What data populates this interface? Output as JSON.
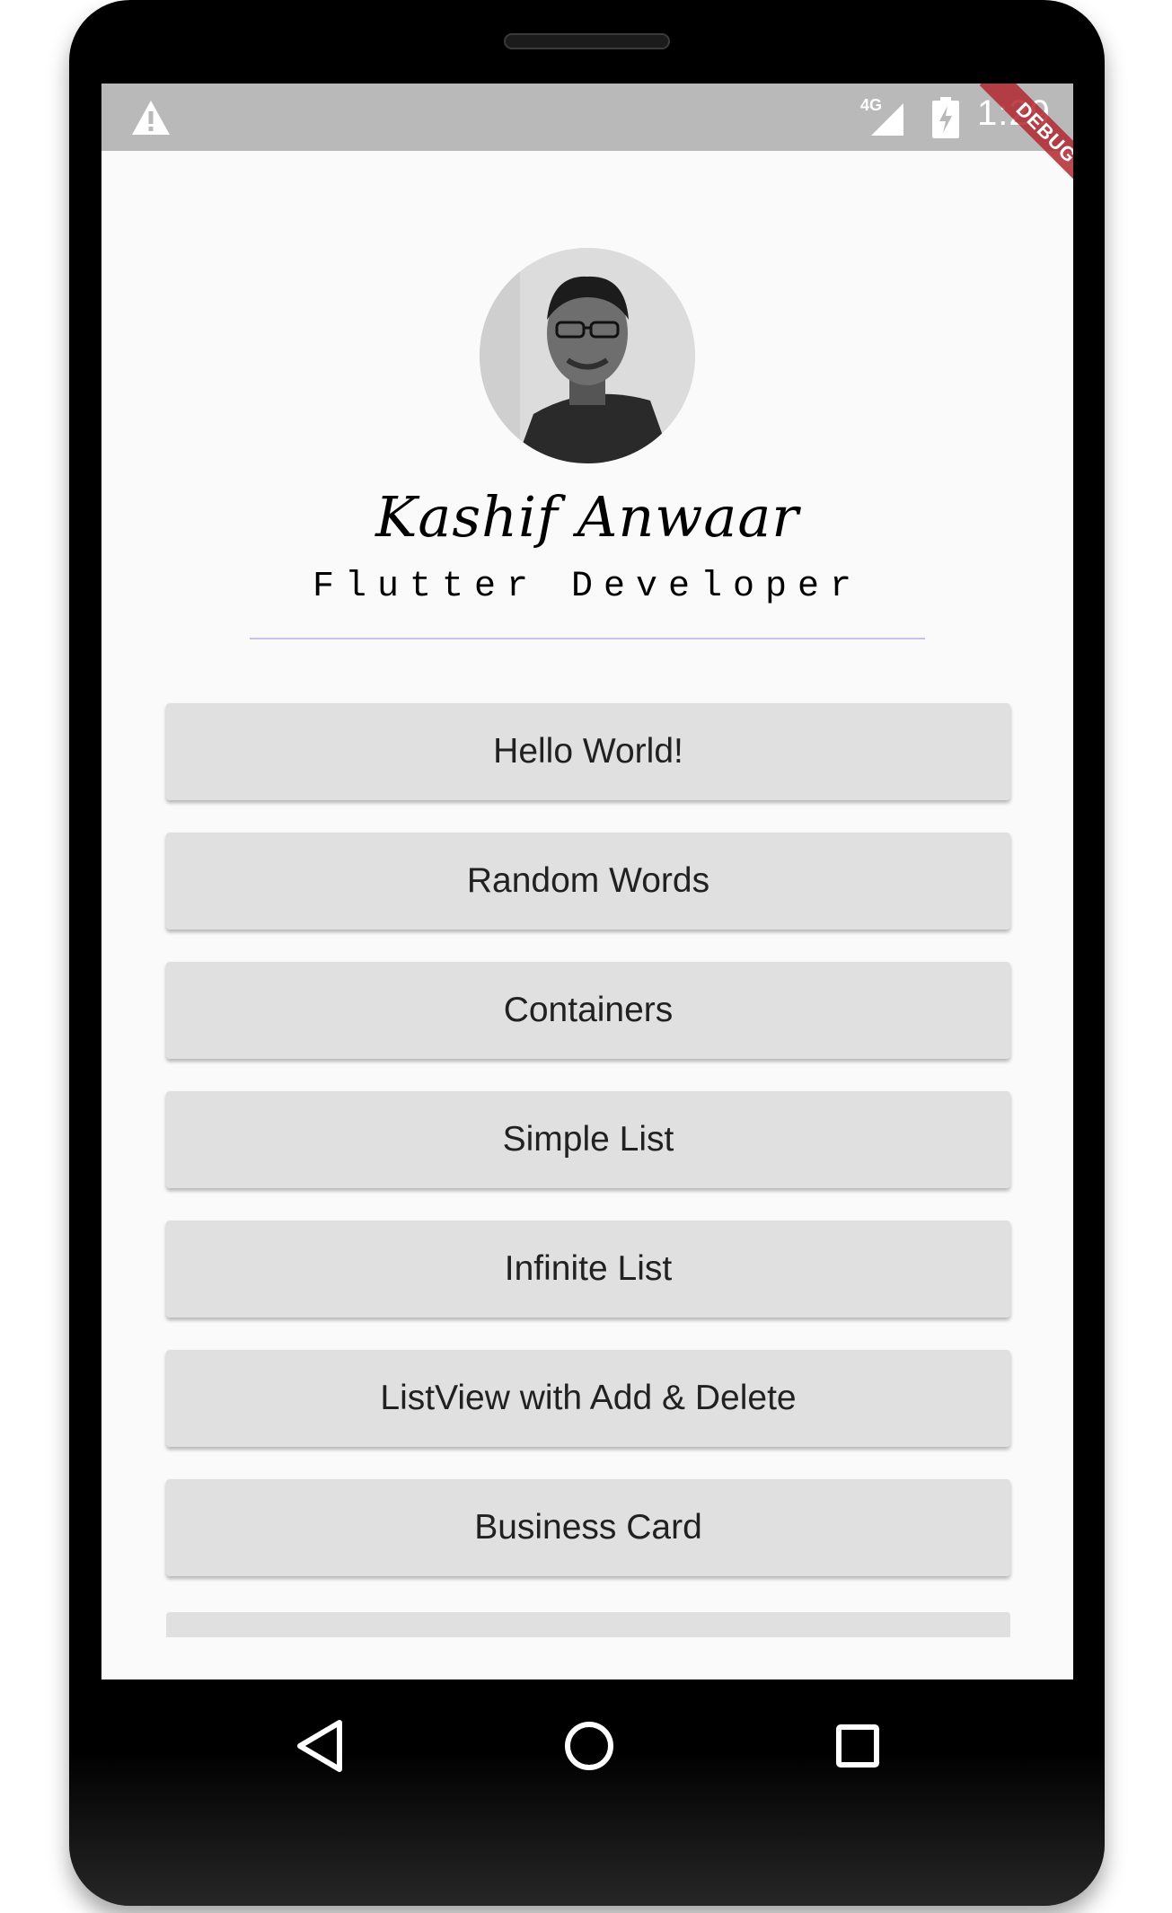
{
  "status_bar": {
    "network": "4G",
    "time": "1:29",
    "warning_icon": "warning-icon",
    "signal_icon": "signal-icon",
    "battery_icon": "battery-charging-icon"
  },
  "debug_banner": {
    "label": "DEBUG"
  },
  "profile": {
    "name": "Kashif Anwaar",
    "title": "Flutter Developer"
  },
  "buttons": [
    {
      "label": "Hello World!"
    },
    {
      "label": "Random Words"
    },
    {
      "label": "Containers"
    },
    {
      "label": "Simple List"
    },
    {
      "label": "Infinite List"
    },
    {
      "label": "ListView with Add & Delete"
    },
    {
      "label": "Business Card"
    }
  ],
  "nav_bar": {
    "back_icon": "back-triangle-icon",
    "home_icon": "home-circle-icon",
    "recents_icon": "recents-square-icon"
  },
  "colors": {
    "status_bar": "#b9b9b9",
    "screen_background": "#fafafa",
    "button_background": "#e0e0e0",
    "divider": "#c9c1f0",
    "debug_ribbon": "#b0272f"
  }
}
